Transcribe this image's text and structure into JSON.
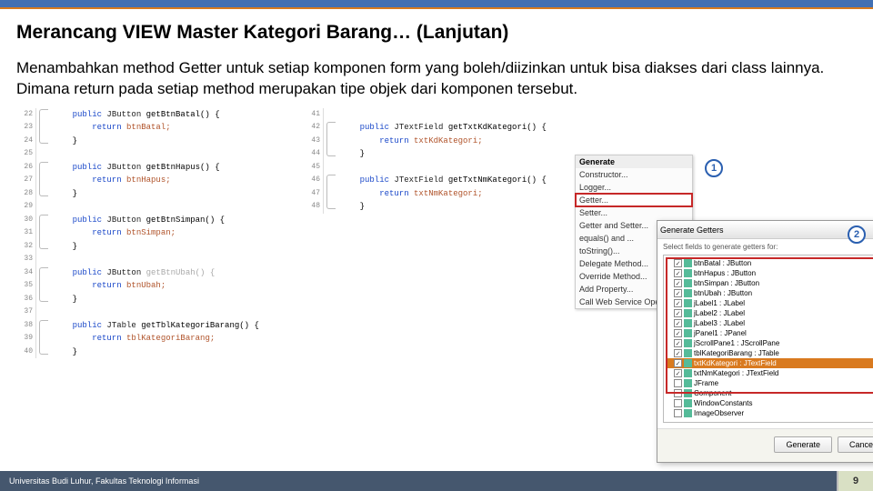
{
  "title": "Merancang VIEW Master Kategori Barang… (Lanjutan)",
  "description": "Menambahkan method Getter untuk setiap komponen form yang boleh/diizinkan untuk bisa diakses dari class lainnya. Dimana return pada setiap method merupakan tipe objek dari komponen tersebut.",
  "callouts": {
    "one": "1",
    "two": "2"
  },
  "code1": [
    {
      "n": "22",
      "k": "public",
      "t": " JButton ",
      "m": "getBtnBatal() {"
    },
    {
      "n": "23",
      "r": "        return",
      "v": " btnBatal;"
    },
    {
      "n": "24",
      "c": "    }"
    },
    {
      "n": "25",
      "c": ""
    },
    {
      "n": "26",
      "k": "public",
      "t": " JButton ",
      "m": "getBtnHapus() {"
    },
    {
      "n": "27",
      "r": "        return",
      "v": " btnHapus;"
    },
    {
      "n": "28",
      "c": "    }"
    },
    {
      "n": "29",
      "c": ""
    },
    {
      "n": "30",
      "k": "public",
      "t": " JButton ",
      "m": "getBtnSimpan() {"
    },
    {
      "n": "31",
      "r": "        return",
      "v": " btnSimpan;"
    },
    {
      "n": "32",
      "c": "    }"
    },
    {
      "n": "33",
      "c": ""
    },
    {
      "n": "34",
      "k": "public",
      "t": " JButton ",
      "m": "getBtnUbah() {",
      "dim": true
    },
    {
      "n": "35",
      "r": "        return",
      "v": " btnUbah;",
      "dim": true
    },
    {
      "n": "36",
      "c": "    }"
    },
    {
      "n": "37",
      "c": ""
    },
    {
      "n": "38",
      "k": "public",
      "t": " JTable ",
      "m": "getTblKategoriBarang() {"
    },
    {
      "n": "39",
      "r": "        return",
      "v": " tblKategoriBarang;",
      "dim": true
    },
    {
      "n": "40",
      "c": "    }"
    }
  ],
  "code2": [
    {
      "n": "41",
      "c": ""
    },
    {
      "n": "42",
      "k": "public",
      "t": " JTextField ",
      "m": "getTxtKdKategori() {"
    },
    {
      "n": "43",
      "r": "        return",
      "v": " txtKdKategori;"
    },
    {
      "n": "44",
      "c": "    }"
    },
    {
      "n": "45",
      "c": ""
    },
    {
      "n": "46",
      "k": "public",
      "t": " JTextField ",
      "m": "getTxtNmKategori() {"
    },
    {
      "n": "47",
      "r": "        return",
      "v": " txtNmKategori;"
    },
    {
      "n": "48",
      "c": "    }"
    }
  ],
  "genmenu": {
    "title": "Generate",
    "items": [
      "Constructor...",
      "Logger...",
      "Getter...",
      "Setter...",
      "Getter and Setter...",
      "equals() and ...",
      "toString()...",
      "Delegate Method...",
      "Override Method...",
      "Add Property...",
      "Call Web Service Operation..."
    ]
  },
  "dialog": {
    "title": "Generate Getters",
    "label": "Select fields to generate getters for:",
    "tree": [
      {
        "chk": true,
        "txt": "btnBatal : JButton"
      },
      {
        "chk": true,
        "txt": "btnHapus : JButton"
      },
      {
        "chk": true,
        "txt": "btnSimpan : JButton"
      },
      {
        "chk": true,
        "txt": "btnUbah : JButton"
      },
      {
        "chk": true,
        "txt": "jLabel1 : JLabel"
      },
      {
        "chk": true,
        "txt": "jLabel2 : JLabel"
      },
      {
        "chk": true,
        "txt": "jLabel3 : JLabel"
      },
      {
        "chk": true,
        "txt": "jPanel1 : JPanel"
      },
      {
        "chk": true,
        "txt": "jScrollPane1 : JScrollPane"
      },
      {
        "chk": true,
        "txt": "tblKategoriBarang : JTable"
      },
      {
        "chk": true,
        "txt": "txtKdKategori : JTextField",
        "sel": true
      },
      {
        "chk": true,
        "txt": "txtNmKategori : JTextField"
      },
      {
        "chk": false,
        "txt": "JFrame"
      },
      {
        "chk": false,
        "txt": "Component"
      },
      {
        "chk": false,
        "txt": "WindowConstants"
      },
      {
        "chk": false,
        "txt": "ImageObserver"
      }
    ],
    "gen": "Generate",
    "cancel": "Cancel"
  },
  "footer": "Universitas Budi Luhur, Fakultas Teknologi Informasi",
  "pagenum": "9"
}
